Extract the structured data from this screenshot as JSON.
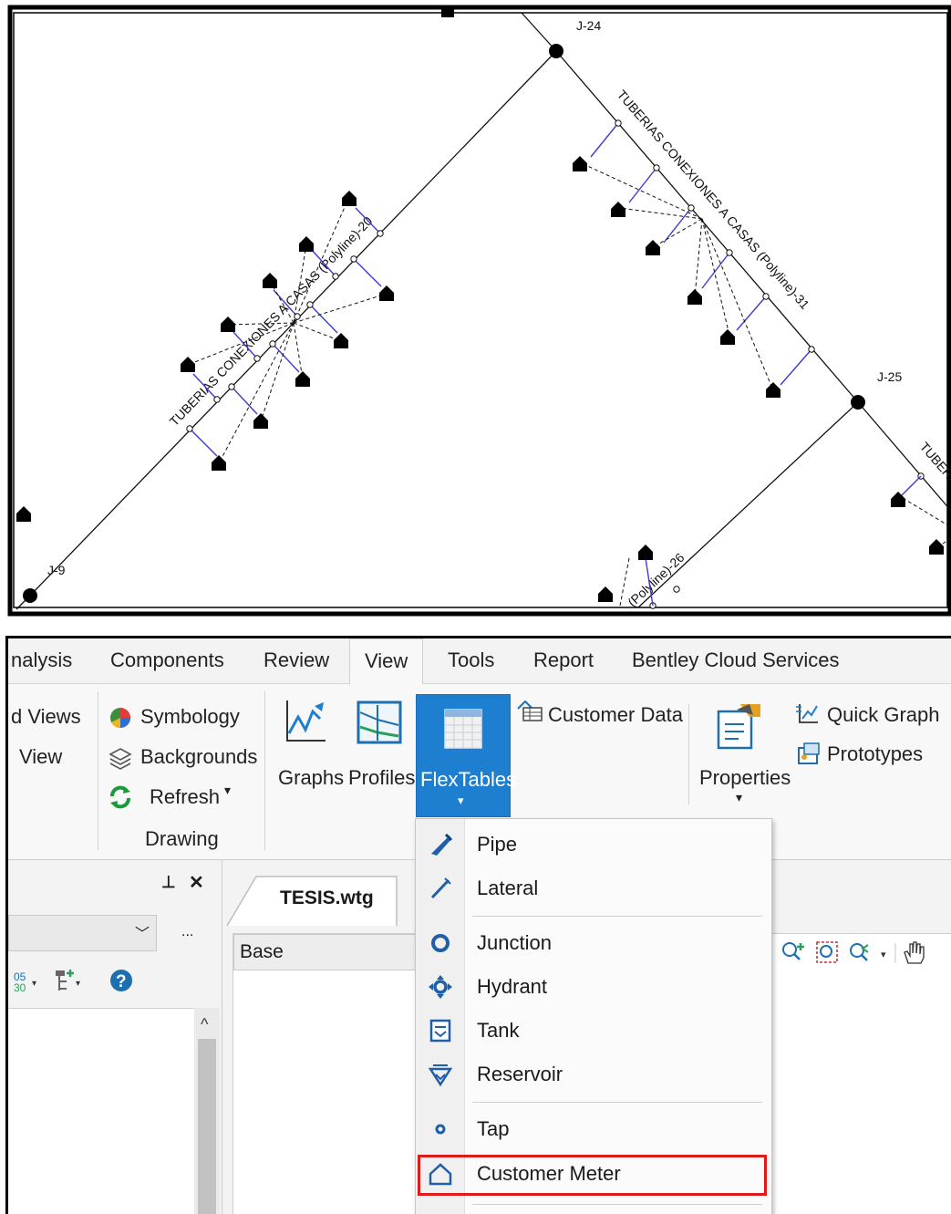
{
  "map": {
    "junctions": [
      "J-24",
      "J-25",
      "J-9"
    ],
    "pipe_labels": [
      "TUBERIAS CONEXIONES A CASAS (Polyline)-20",
      "TUBERIAS CONEXIONES A CASAS (Polyline)-31",
      "(Polyline)-26",
      "TUBERI"
    ]
  },
  "ribbon": {
    "tabs": [
      "nalysis",
      "Components",
      "Review",
      "View",
      "Tools",
      "Report",
      "Bentley Cloud Services"
    ],
    "active_tab": "View",
    "buttons": {
      "named_views": "d Views",
      "view": "View",
      "symbology": "Symbology",
      "backgrounds": "Backgrounds",
      "refresh": "Refresh",
      "group_drawing": "Drawing",
      "graphs": "Graphs",
      "profiles": "Profiles",
      "flextables": "FlexTables",
      "customer_data": "Customer Data",
      "properties": "Properties",
      "quick_graph": "Quick Graph",
      "prototypes": "Prototypes"
    }
  },
  "left_pane": {
    "pin": "ᵖ",
    "close": "✕",
    "more": "...",
    "scroll_up": "^"
  },
  "document": {
    "tab_title": "TESIS.wtg",
    "scenario": "Base"
  },
  "flextables_menu": {
    "items": [
      "Pipe",
      "Lateral",
      "Junction",
      "Hydrant",
      "Tank",
      "Reservoir",
      "Tap",
      "Customer Meter"
    ],
    "highlighted": "Customer Meter"
  },
  "colors": {
    "accent": "#1e7fd0",
    "highlight_border": "#e0191b",
    "lateral_line": "#3b3bd6"
  }
}
